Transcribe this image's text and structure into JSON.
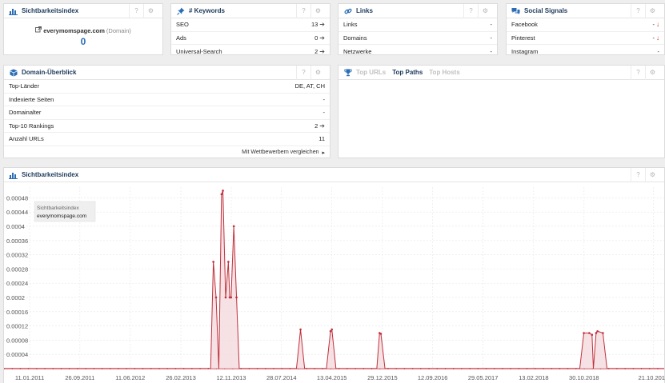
{
  "panels": {
    "sichtbarkeit": {
      "title": "Sichtbarkeitsindex",
      "domain": "everymomspage.com",
      "domain_suffix": "(Domain)",
      "value": "0"
    },
    "keywords": {
      "title": "# Keywords",
      "rows": [
        {
          "label": "SEO",
          "value": "13"
        },
        {
          "label": "Ads",
          "value": "0"
        },
        {
          "label": "Universal-Search",
          "value": "2"
        }
      ]
    },
    "links": {
      "title": "Links",
      "rows": [
        {
          "label": "Links",
          "value": "-"
        },
        {
          "label": "Domains",
          "value": "-"
        },
        {
          "label": "Netzwerke",
          "value": "-"
        }
      ]
    },
    "social": {
      "title": "Social Signals",
      "rows": [
        {
          "label": "Facebook",
          "value": "-"
        },
        {
          "label": "Pinterest",
          "value": "-"
        },
        {
          "label": "Instagram",
          "value": "-"
        }
      ]
    },
    "domain_overview": {
      "title": "Domain-Überblick",
      "rows": [
        {
          "label": "Top-Länder",
          "value": "DE, AT, CH"
        },
        {
          "label": "Indexierte Seiten",
          "value": "-"
        },
        {
          "label": "Domainalter",
          "value": "-"
        },
        {
          "label": "Top-10 Rankings",
          "value": "2"
        },
        {
          "label": "Anzahl URLs",
          "value": "11"
        }
      ],
      "compare_link": "Mit Wettbewerbern vergleichen"
    },
    "top_tabs": {
      "tabs": [
        "Top URLs",
        "Top Paths",
        "Top Hosts"
      ],
      "active": 1
    },
    "chart_panel": {
      "title": "Sichtbarkeitsindex"
    }
  },
  "header_icons": {
    "help": "?",
    "settings": "⚙"
  },
  "colors": {
    "brand": "#1d3a5c",
    "accent": "#2a6db5",
    "line": "#c0303c",
    "fill": "#f3d8dc",
    "down": "#c62828"
  },
  "chart_data": {
    "type": "area",
    "title": "",
    "tooltip": {
      "label": "Sichtbarkeitsindex",
      "domain": "everymomspage.com"
    },
    "y_ticks": [
      4e-05,
      8e-05,
      0.00012,
      0.00016,
      0.0002,
      0.00024,
      0.00028,
      0.00032,
      0.00036,
      0.0004,
      0.00044,
      0.00048
    ],
    "y_tick_labels": [
      "0.00004",
      "0.00008",
      "0.00012",
      "0.00016",
      "0.0002",
      "0.00024",
      "0.00028",
      "0.00032",
      "0.00036",
      "0.0004",
      "0.00044",
      "0.00048"
    ],
    "ylim": [
      0,
      0.00051
    ],
    "xlim": [
      "2010-09-01",
      "2019-12-16"
    ],
    "x_ticks": [
      "2011-01-11",
      "2011-09-26",
      "2012-06-11",
      "2013-02-26",
      "2013-11-12",
      "2014-07-28",
      "2015-04-13",
      "2015-12-29",
      "2016-09-12",
      "2017-05-29",
      "2018-02-13",
      "2018-10-30",
      "2019-10-21"
    ],
    "x_tick_labels": [
      "11.01.2011",
      "26.09.2011",
      "11.06.2012",
      "26.02.2013",
      "12.11.2013",
      "28.07.2014",
      "13.04.2015",
      "29.12.2015",
      "12.09.2016",
      "29.05.2017",
      "13.02.2018",
      "30.10.2018",
      "21.10.2019"
    ],
    "series": [
      {
        "points": [
          [
            "2013-07-29",
            0
          ],
          [
            "2013-08-12",
            0.0003
          ],
          [
            "2013-08-26",
            0.0002
          ],
          [
            "2013-09-09",
            0
          ],
          [
            "2013-09-23",
            0.00049
          ],
          [
            "2013-09-30",
            0.0005
          ],
          [
            "2013-10-14",
            0.0002
          ],
          [
            "2013-10-28",
            0.0003
          ],
          [
            "2013-11-04",
            0.0002
          ],
          [
            "2013-11-11",
            0.0002
          ],
          [
            "2013-11-25",
            0.0004
          ],
          [
            "2013-12-09",
            0.0002
          ],
          [
            "2013-12-23",
            0
          ],
          [
            "2014-10-13",
            0
          ],
          [
            "2014-11-03",
            0.00011
          ],
          [
            "2014-11-24",
            0
          ],
          [
            "2015-03-16",
            0
          ],
          [
            "2015-04-06",
            0.000105
          ],
          [
            "2015-04-13",
            0.00011
          ],
          [
            "2015-05-04",
            0
          ],
          [
            "2015-11-30",
            0
          ],
          [
            "2015-12-14",
            0.0001
          ],
          [
            "2015-12-21",
            9.8e-05
          ],
          [
            "2016-01-11",
            0
          ],
          [
            "2018-10-08",
            0
          ],
          [
            "2018-10-29",
            0.0001
          ],
          [
            "2018-11-26",
            0.0001
          ],
          [
            "2018-12-10",
            9.5e-05
          ],
          [
            "2018-12-17",
            0
          ],
          [
            "2018-12-31",
            0.0001
          ],
          [
            "2019-01-07",
            0.000105
          ],
          [
            "2019-02-04",
            0.0001
          ],
          [
            "2019-02-25",
            0
          ]
        ]
      }
    ]
  }
}
